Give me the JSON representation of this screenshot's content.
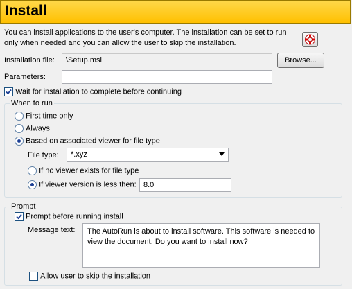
{
  "header": {
    "title": "Install"
  },
  "description": "You can install applications to the user's computer. The installation can be set to run only when needed and you can allow the user to skip the installation.",
  "help_icon": "lifebuoy-help-icon",
  "installation_file": {
    "label": "Installation file:",
    "value": "\\Setup.msi",
    "browse_label": "Browse..."
  },
  "parameters": {
    "label": "Parameters:",
    "value": ""
  },
  "wait_checkbox": {
    "label": "Wait for installation to complete before continuing",
    "checked": true
  },
  "when_to_run": {
    "legend": "When to run",
    "options": [
      {
        "label": "First time only",
        "selected": false
      },
      {
        "label": "Always",
        "selected": false
      },
      {
        "label": "Based on associated viewer for file type",
        "selected": true
      }
    ],
    "file_type": {
      "label": "File type:",
      "value": "*.xyz"
    },
    "sub_options": [
      {
        "label": "If no viewer exists for file type",
        "selected": false
      },
      {
        "label": "If viewer version is less then:",
        "selected": true
      }
    ],
    "version_value": "8.0"
  },
  "prompt": {
    "legend": "Prompt",
    "checkbox": {
      "label": "Prompt before running install",
      "checked": true
    },
    "message_label": "Message text:",
    "message_value": "The AutoRun is about to install software. This software is needed to view the document. Do you want to install now?",
    "skip_checkbox": {
      "label": "Allow user to skip the installation",
      "checked": false
    }
  }
}
